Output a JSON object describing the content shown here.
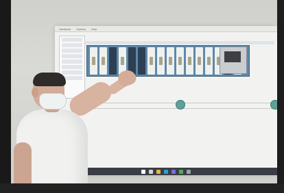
{
  "projection": {
    "menu": [
      "Hardware",
      "Options",
      "Help"
    ],
    "title": "",
    "info_text": ""
  },
  "colors": {
    "rack": "#5e88a8",
    "slot_dark": "#2d3f52",
    "slot_light": "#eef1ef",
    "wall": "#d9dad6",
    "shirt": "#f1f1f0",
    "taskbar": "#3a3d45",
    "icon_teal": "#5fa19a"
  },
  "taskbar_icons": [
    "search-icon",
    "taskview-icon",
    "explorer-icon",
    "edge-icon",
    "store-icon",
    "chrome-icon",
    "settings-icon"
  ]
}
